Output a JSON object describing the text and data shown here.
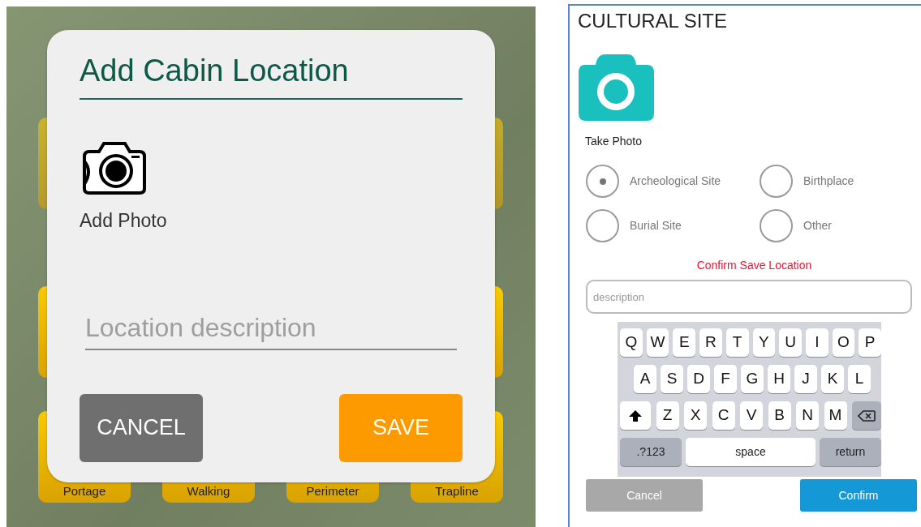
{
  "background_app": {
    "labeled_tiles": [
      {
        "label": "Portage"
      },
      {
        "label": "Walking"
      },
      {
        "label": "Perimeter"
      },
      {
        "label": "Trapline"
      }
    ]
  },
  "cabin_dialog": {
    "title": "Add Cabin Location",
    "photo_label": "Add Photo",
    "description_field": {
      "placeholder": "Location description"
    },
    "buttons": [
      {
        "label": "CANCEL",
        "kind": "cancel"
      },
      {
        "label": "SAVE",
        "kind": "save"
      }
    ]
  },
  "cultural_site": {
    "title": "CULTURAL SITE",
    "photo_label": "Take Photo",
    "site_types": [
      {
        "label": "Archeological Site",
        "selected": true
      },
      {
        "label": "Birthplace",
        "selected": false
      },
      {
        "label": "Burial Site",
        "selected": false
      },
      {
        "label": "Other",
        "selected": false
      }
    ],
    "confirm_prompt": "Confirm Save Location",
    "description_field": {
      "placeholder": "description"
    },
    "keyboard": {
      "rows": [
        {
          "keys": [
            {
              "kind": "letter",
              "label": "Q"
            },
            {
              "kind": "letter",
              "label": "W"
            },
            {
              "kind": "letter",
              "label": "E"
            },
            {
              "kind": "letter",
              "label": "R"
            },
            {
              "kind": "letter",
              "label": "T"
            },
            {
              "kind": "letter",
              "label": "Y"
            },
            {
              "kind": "letter",
              "label": "U"
            },
            {
              "kind": "letter",
              "label": "I"
            },
            {
              "kind": "letter",
              "label": "O"
            },
            {
              "kind": "letter",
              "label": "P"
            }
          ]
        },
        {
          "keys": [
            {
              "kind": "letter",
              "label": "A"
            },
            {
              "kind": "letter",
              "label": "S"
            },
            {
              "kind": "letter",
              "label": "D"
            },
            {
              "kind": "letter",
              "label": "F"
            },
            {
              "kind": "letter",
              "label": "G"
            },
            {
              "kind": "letter",
              "label": "H"
            },
            {
              "kind": "letter",
              "label": "J"
            },
            {
              "kind": "letter",
              "label": "K"
            },
            {
              "kind": "letter",
              "label": "L"
            }
          ]
        },
        {
          "keys": [
            {
              "kind": "shift"
            },
            {
              "kind": "letter",
              "label": "Z"
            },
            {
              "kind": "letter",
              "label": "X"
            },
            {
              "kind": "letter",
              "label": "C"
            },
            {
              "kind": "letter",
              "label": "V"
            },
            {
              "kind": "letter",
              "label": "B"
            },
            {
              "kind": "letter",
              "label": "N"
            },
            {
              "kind": "letter",
              "label": "M"
            },
            {
              "kind": "backspace"
            }
          ]
        },
        {
          "keys": [
            {
              "kind": "function",
              "label": ".?123"
            },
            {
              "kind": "space",
              "label": "space"
            },
            {
              "kind": "function",
              "label": "return"
            }
          ]
        }
      ]
    },
    "buttons": [
      {
        "label": "Cancel",
        "kind": "cancel"
      },
      {
        "label": "Confirm",
        "kind": "confirm"
      }
    ]
  }
}
